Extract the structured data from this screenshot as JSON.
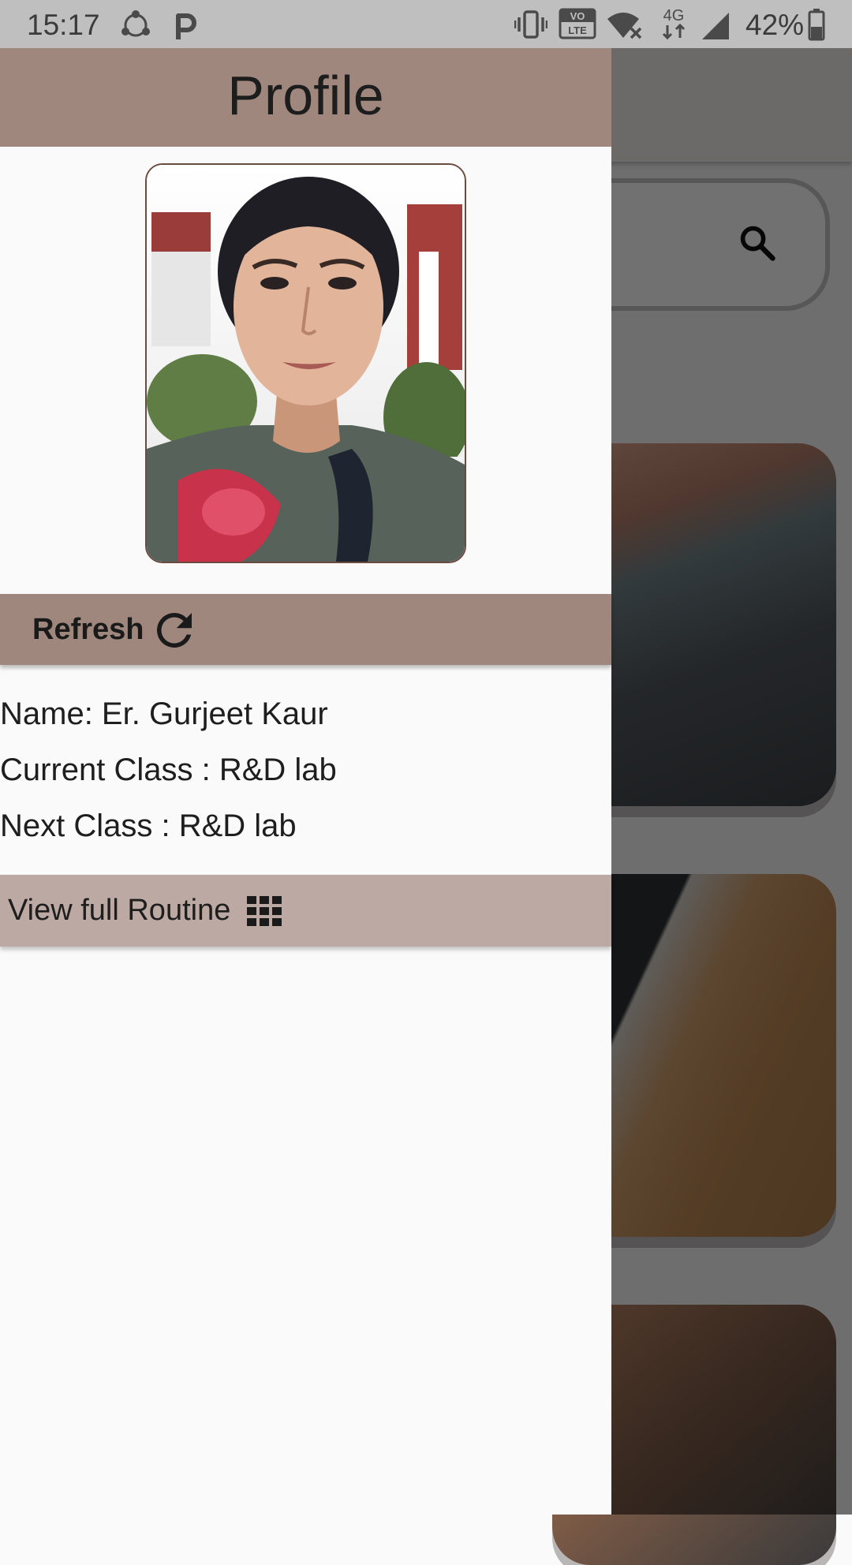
{
  "status_bar": {
    "time": "15:17",
    "battery_percent": "42%",
    "left_icons": [
      "share-icon",
      "p-icon"
    ],
    "right_icons": [
      "vibrate-icon",
      "volte-icon",
      "wifi-off-icon",
      "4g-icon",
      "signal-icon",
      "battery-icon"
    ],
    "volte_label_top": "VO",
    "volte_label_bottom": "LTE",
    "network_label": "4G"
  },
  "drawer": {
    "title": "Profile",
    "refresh_label": "Refresh",
    "refresh_icon": "refresh-icon",
    "info": {
      "name": "Name: Er. Gurjeet Kaur",
      "current_class": "Current Class : R&D lab",
      "next_class": "Next Class : R&D lab"
    },
    "routine_label": "View full Routine",
    "routine_icon": "grid-icon"
  },
  "background": {
    "search_icon": "search-icon"
  },
  "colors": {
    "header_brown": "#a0877d",
    "routine_bar": "#bca9a3",
    "photo_border": "#6b4a40"
  }
}
